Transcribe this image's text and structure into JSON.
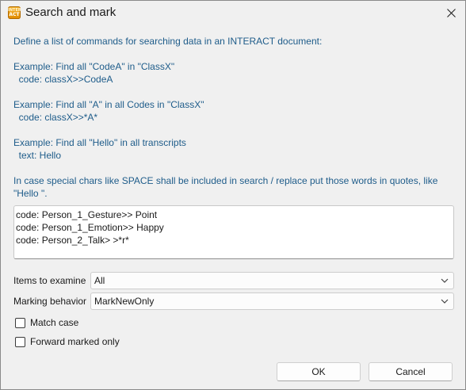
{
  "window": {
    "title": "Search and mark",
    "icon_text_top": "INTER",
    "icon_text_bottom": "ACT"
  },
  "intro": "Define a list of commands for searching data in an INTERACT document:",
  "examples": [
    {
      "line1": "Example: Find all \"CodeA\" in \"ClassX\"",
      "line2": "  code: classX>>CodeA"
    },
    {
      "line1": "Example: Find all \"A\" in all Codes in \"ClassX\"",
      "line2": "  code: classX>>*A*"
    },
    {
      "line1": "Example: Find all \"Hello\" in all transcripts",
      "line2": "  text: Hello"
    }
  ],
  "special_chars_note": "In case special chars like SPACE shall be included in search / replace put those words in quotes, like \"Hello \".",
  "commands_text": "code: Person_1_Gesture>> Point\ncode: Person_1_Emotion>> Happy\ncode: Person_2_Talk> >*r*",
  "items_to_examine": {
    "label": "Items to examine",
    "value": "All"
  },
  "marking_behavior": {
    "label": "Marking behavior",
    "value": "MarkNewOnly"
  },
  "match_case": {
    "label": "Match case",
    "checked": false
  },
  "forward_marked_only": {
    "label": "Forward marked only",
    "checked": false
  },
  "buttons": {
    "ok": "OK",
    "cancel": "Cancel"
  },
  "colors": {
    "info_text": "#1e5c8a",
    "dialog_bg": "#f0f0f0",
    "icon_orange": "#f0a020"
  },
  "icons": {
    "close": "close-icon",
    "dropdown": "chevron-down-icon",
    "app": "interact-app-icon"
  }
}
